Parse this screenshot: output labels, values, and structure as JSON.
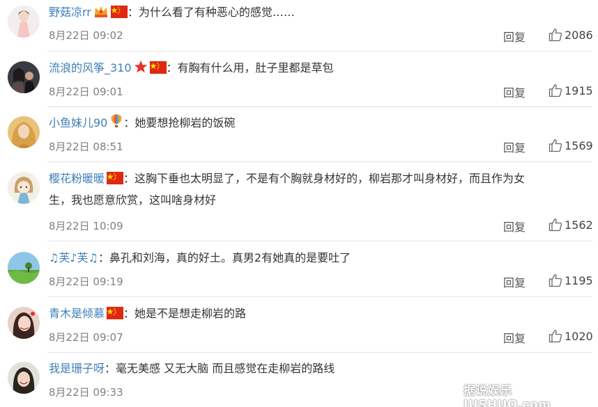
{
  "comments": [
    {
      "user": "野菇凉rr",
      "text": "：为什么看了有种恶心的感觉……",
      "text2": "",
      "time": "8月22日 09:02",
      "reply": "回复",
      "likes": "2086",
      "avatar_icon": "avatar-doll-icon",
      "badges": [
        "crown-icon",
        "china-flag-icon"
      ]
    },
    {
      "user": "流浪的风筝_310",
      "text": "：有胸有什么用，肚子里都是草包",
      "text2": "",
      "time": "8月22日 09:01",
      "reply": "回复",
      "likes": "1915",
      "avatar_icon": "avatar-couple-icon",
      "badges": [
        "star-icon",
        "china-flag-icon"
      ]
    },
    {
      "user": "小鱼妹儿90",
      "text": "：她要想抢柳岩的饭碗",
      "text2": "",
      "time": "8月22日 08:51",
      "reply": "回复",
      "likes": "1569",
      "avatar_icon": "avatar-woman-icon",
      "badges": [
        "balloon-icon"
      ]
    },
    {
      "user": "樱花粉暖暖",
      "text": "：这胸下垂也太明显了，不是有个胸就身材好的，柳岩那才叫身材好，而且作为女",
      "text2": "生，我也愿意欣赏，这叫啥身材好",
      "time": "8月22日 10:09",
      "reply": "回复",
      "likes": "1562",
      "avatar_icon": "avatar-cartoon-girl-icon",
      "badges": [
        "china-flag-icon"
      ]
    },
    {
      "user": "♫芙♪芙♫",
      "text": "：鼻孔和刘海，真的好土。真男2有她真的是要吐了",
      "text2": "",
      "time": "8月22日 09:19",
      "reply": "回复",
      "likes": "1195",
      "avatar_icon": "avatar-meadow-icon",
      "badges": []
    },
    {
      "user": "青木是倾慕",
      "text": "：她是不是想走柳岩的路",
      "text2": "",
      "time": "8月22日 09:07",
      "reply": "回复",
      "likes": "1020",
      "avatar_icon": "avatar-selfie-icon",
      "badges": [
        "china-flag-icon"
      ]
    },
    {
      "user": "我是珊子呀",
      "text": "：毫无美感 又无大脑 而且感觉在走柳岩的路线",
      "text2": "",
      "time": "8月22日 09:33",
      "reply": "",
      "likes": "",
      "avatar_icon": "avatar-smile-icon",
      "badges": []
    }
  ],
  "watermark": "据说娱乐JUSHUO.com",
  "colors": {
    "username": "#3e7fb8",
    "time": "#808080",
    "divider": "#e3e3e3"
  }
}
